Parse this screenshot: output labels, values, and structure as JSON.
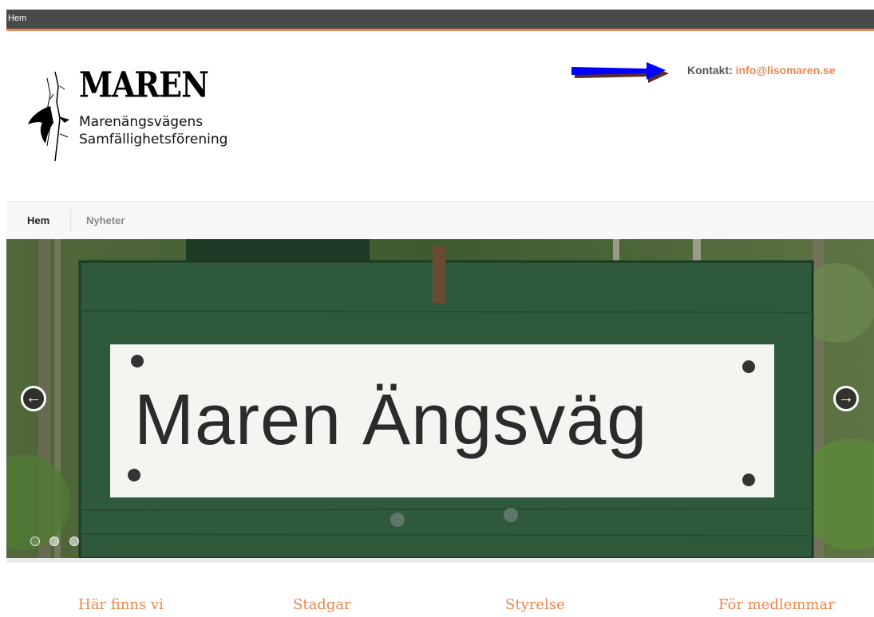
{
  "topbar": {
    "label": "Hem"
  },
  "logo": {
    "title": "MAREN",
    "subtitle_line1": "Marenängsvägens",
    "subtitle_line2": "Samfällighetsförening"
  },
  "contact": {
    "label": "Kontakt:",
    "email": "info@lisomaren.se",
    "arrow_color": "#0000ff"
  },
  "nav": {
    "items": [
      {
        "label": "Hem",
        "active": true
      },
      {
        "label": "Nyheter",
        "active": false
      }
    ]
  },
  "slider": {
    "sign_text": "Maren Ängsväg",
    "prev_icon": "arrow-left-icon",
    "next_icon": "arrow-right-icon",
    "slide_count": 3,
    "active_slide": 1
  },
  "bottom_links": [
    {
      "label": "Här finns vi"
    },
    {
      "label": "Stadgar"
    },
    {
      "label": "Styrelse"
    },
    {
      "label": "För medlemmar"
    }
  ],
  "colors": {
    "accent": "#e8874f",
    "topbar": "#4a4a4a",
    "sign_green": "#2f5a3c"
  }
}
